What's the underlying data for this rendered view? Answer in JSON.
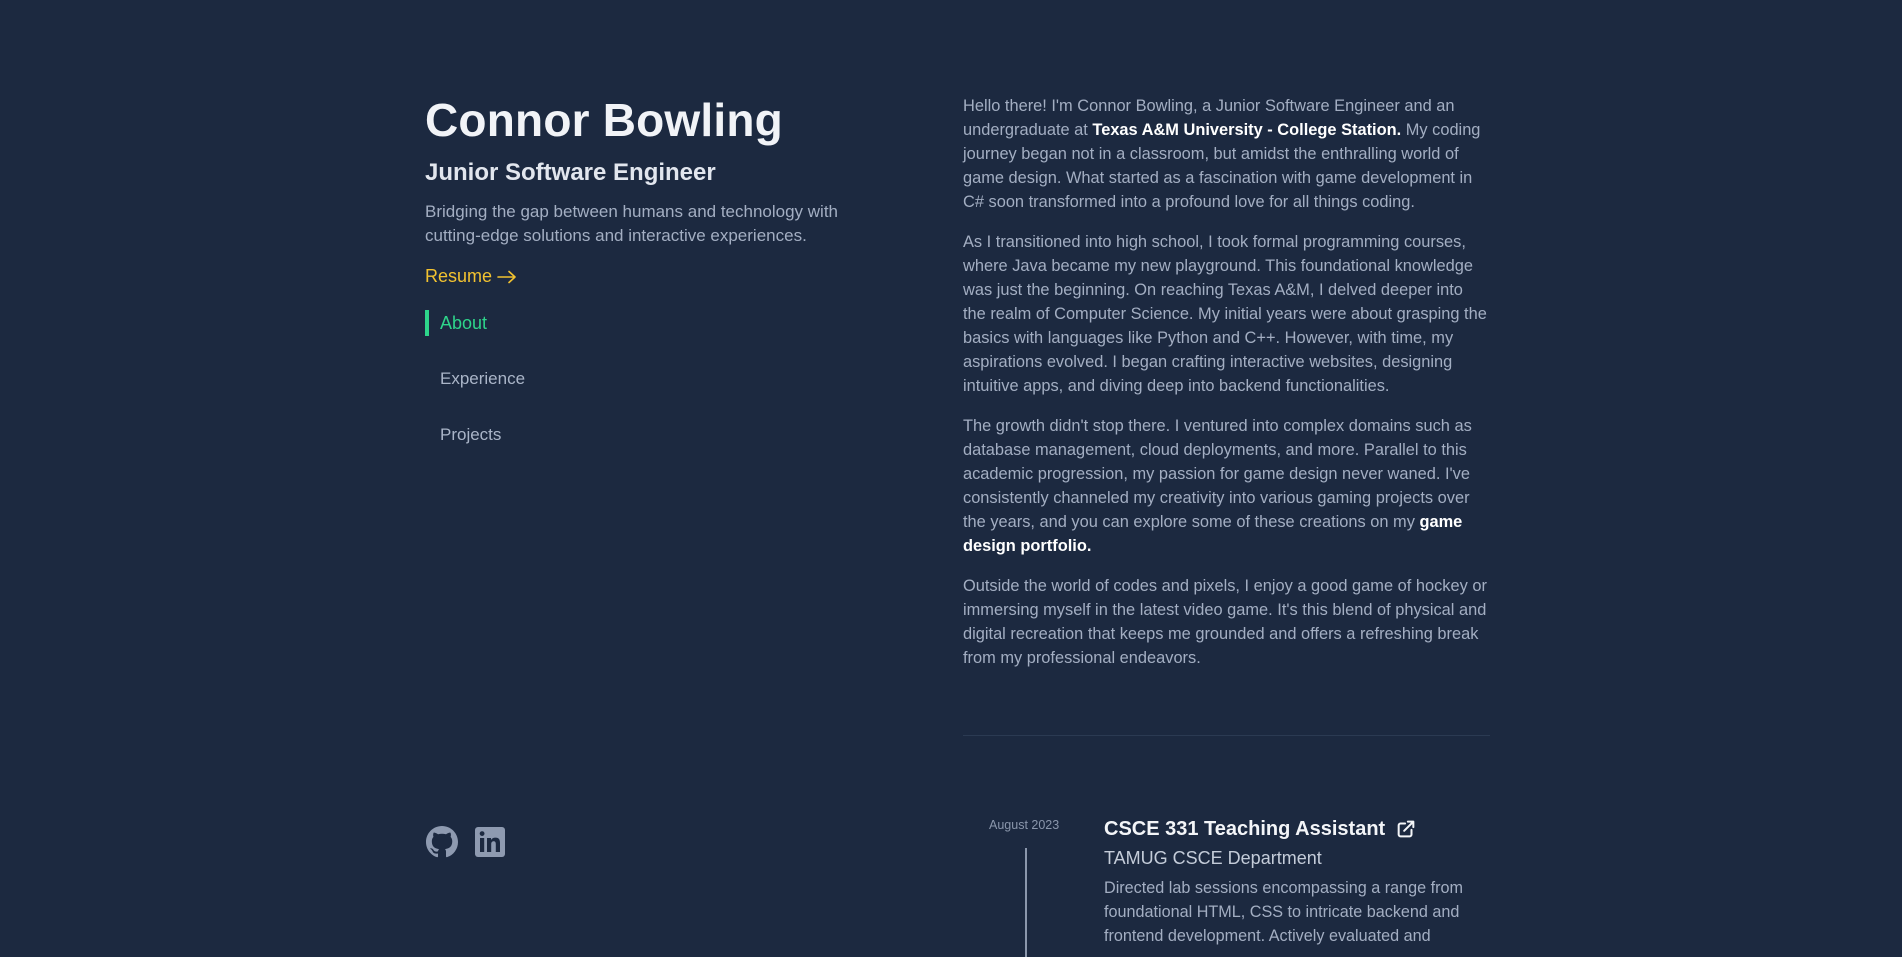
{
  "profile": {
    "name": "Connor Bowling",
    "role": "Junior Software Engineer",
    "tagline": "Bridging the gap between humans and technology with cutting-edge solutions and interactive experiences.",
    "resume_label": "Resume"
  },
  "nav": {
    "items": [
      {
        "label": "About",
        "active": true
      },
      {
        "label": "Experience",
        "active": false
      },
      {
        "label": "Projects",
        "active": false
      }
    ]
  },
  "socials": [
    {
      "icon": "github-icon"
    },
    {
      "icon": "linkedin-icon"
    }
  ],
  "about": {
    "p1": {
      "t1": "Hello there! I'm Connor Bowling, a Junior Software Engineer and an undergraduate at ",
      "b1": "Texas A&M University - College Station.",
      "t2": " My coding journey began not in a classroom, but amidst the enthralling world of game design. What started as a fascination with game development in C# soon transformed into a profound love for all things coding."
    },
    "p2": "As I transitioned into high school, I took formal programming courses, where Java became my new playground. This foundational knowledge was just the beginning. On reaching Texas A&M, I delved deeper into the realm of Computer Science. My initial years were about grasping the basics with languages like Python and C++. However, with time, my aspirations evolved. I began crafting interactive websites, designing intuitive apps, and diving deep into backend functionalities.",
    "p3": {
      "t1": "The growth didn't stop there. I ventured into complex domains such as database management, cloud deployments, and more. Parallel to this academic progression, my passion for game design never waned. I've consistently channeled my creativity into various gaming projects over the years, and you can explore some of these creations on my ",
      "b1": "game design portfolio."
    },
    "p4": "Outside the world of codes and pixels, I enjoy a good game of hockey or immersing myself in the latest video game. It's this blend of physical and digital recreation that keeps me grounded and offers a refreshing break from my professional endeavors."
  },
  "experience": [
    {
      "date": "August 2023",
      "title": "CSCE 331 Teaching Assistant",
      "org": "TAMUG CSCE Department",
      "desc": "Directed lab sessions encompassing a range from foundational HTML, CSS to intricate backend and frontend development. Actively evaluated and"
    }
  ],
  "colors": {
    "background": "#1c2940",
    "accent_green": "#2ed58b",
    "resume_yellow": "#f2c230"
  }
}
